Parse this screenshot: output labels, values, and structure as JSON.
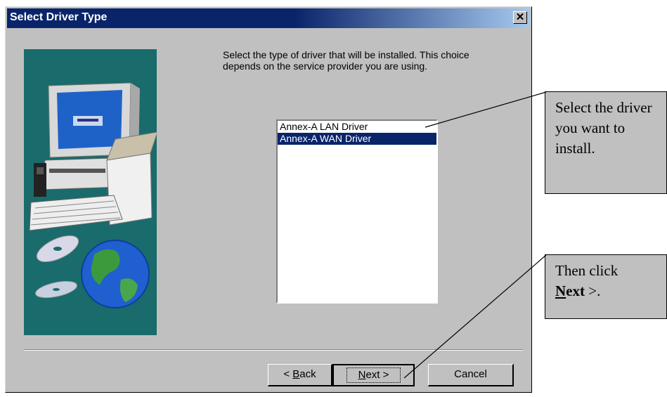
{
  "dialog": {
    "title": "Select Driver Type",
    "close_label": "✕",
    "instruction": "Select the type of driver that will be installed.  This choice depends on the service provider you are using."
  },
  "list": {
    "items": [
      {
        "label": "Annex-A LAN Driver",
        "selected": false
      },
      {
        "label": "Annex-A WAN Driver",
        "selected": true
      }
    ]
  },
  "buttons": {
    "back_prefix": "< ",
    "back_mnemonic": "B",
    "back_rest": "ack",
    "next_mnemonic": "N",
    "next_rest": "ext >",
    "cancel": "Cancel"
  },
  "callouts": {
    "select_text": "Select the driver you want to install.",
    "next_prefix": "Then click",
    "next_bold_mnemonic": "N",
    "next_bold_rest": "ext",
    "next_suffix": " >."
  },
  "colors": {
    "title_bar": "#0a246a",
    "selection": "#0a246a",
    "dialog_face": "#c0c0c0",
    "art_panel": "#1a6b6b"
  },
  "icons": [
    "close-icon",
    "computer-icon",
    "globe-icon",
    "cd-discs-icon"
  ]
}
